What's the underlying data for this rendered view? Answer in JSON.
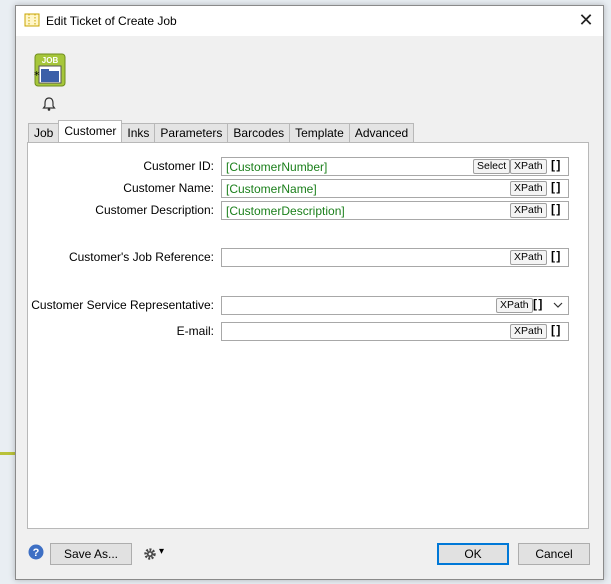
{
  "window": {
    "title": "Edit Ticket of Create Job",
    "close_glyph": "✕"
  },
  "icons": {
    "title": "ticket-icon",
    "job": "job-icon",
    "bell": "bell-icon",
    "help": "help-icon",
    "gear": "gear-icon"
  },
  "job_icon": {
    "label": "JOB"
  },
  "tabs": [
    {
      "label": "Job"
    },
    {
      "label": "Customer",
      "active": true
    },
    {
      "label": "Inks"
    },
    {
      "label": "Parameters"
    },
    {
      "label": "Barcodes"
    },
    {
      "label": "Template"
    },
    {
      "label": "Advanced"
    }
  ],
  "fields": {
    "customer_id": {
      "label": "Customer ID:",
      "value": "[CustomerNumber]",
      "select": "Select",
      "xpath": "XPath",
      "bracket": "[ ]"
    },
    "customer_name": {
      "label": "Customer Name:",
      "value": "[CustomerName]",
      "xpath": "XPath",
      "bracket": "[ ]"
    },
    "customer_description": {
      "label": "Customer Description:",
      "value": "[CustomerDescription]",
      "xpath": "XPath",
      "bracket": "[ ]"
    },
    "job_reference": {
      "label": "Customer's Job Reference:",
      "value": "",
      "xpath": "XPath",
      "bracket": "[ ]"
    },
    "service_rep": {
      "label": "Customer Service Representative:",
      "value": "",
      "xpath": "XPath",
      "bracket": "[ ]"
    },
    "email": {
      "label": "E-mail:",
      "value": "",
      "xpath": "XPath",
      "bracket": "[ ]"
    }
  },
  "footer": {
    "save_as": "Save As...",
    "ok": "OK",
    "cancel": "Cancel",
    "gear_caret": "▾"
  },
  "colors": {
    "field_value": "#1a7f1a",
    "default_button_border": "#0078d7"
  }
}
